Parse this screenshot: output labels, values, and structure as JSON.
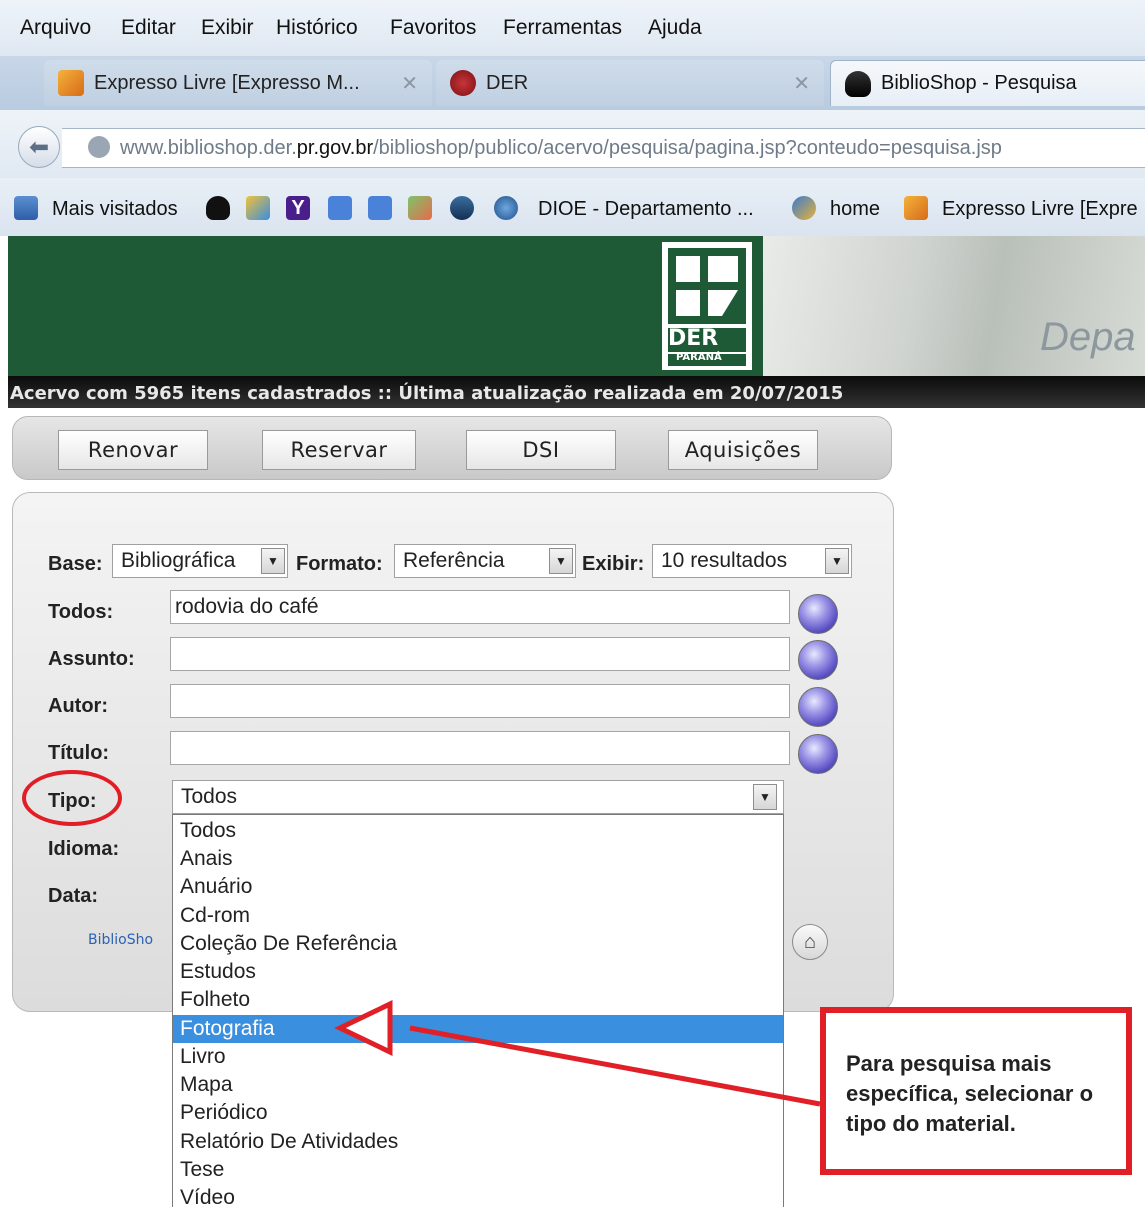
{
  "menu": [
    "Arquivo",
    "Editar",
    "Exibir",
    "Histórico",
    "Favoritos",
    "Ferramentas",
    "Ajuda"
  ],
  "tabs": [
    {
      "title": "Expresso Livre [Expresso M...",
      "icon": "expresso-icon",
      "state": "inactive"
    },
    {
      "title": "DER",
      "icon": "der-shield-icon",
      "state": "inactive"
    },
    {
      "title": "BiblioShop - Pesquisa",
      "icon": "penguin-icon",
      "state": "active"
    }
  ],
  "url": {
    "prefix": "www.biblioshop.der.",
    "domain": "pr.gov.br",
    "path": "/biblioshop/publico/acervo/pesquisa/pagina.jsp?conteudo=pesquisa.jsp"
  },
  "bookmarks": {
    "most_visited": "Mais visitados",
    "dioe": "DIOE - Departamento ...",
    "home": "home",
    "expresso": "Expresso Livre [Expre"
  },
  "banner": {
    "logo_text": "DER",
    "logo_sub": "PARANÁ",
    "road_text": "Depa",
    "status": "Acervo com 5965 itens cadastrados :: Última atualização realizada em 20/07/2015",
    "colors": {
      "green": "#1f5a36",
      "status_bg": "#111111"
    }
  },
  "actions": [
    "Renovar",
    "Reservar",
    "DSI",
    "Aquisições"
  ],
  "search": {
    "base_label": "Base:",
    "base_value": "Bibliográfica",
    "formato_label": "Formato:",
    "formato_value": "Referência",
    "exibir_label": "Exibir:",
    "exibir_value": "10 resultados",
    "todos_label": "Todos:",
    "todos_value": "rodovia do café",
    "assunto_label": "Assunto:",
    "assunto_value": "",
    "autor_label": "Autor:",
    "autor_value": "",
    "titulo_label": "Título:",
    "titulo_value": "",
    "tipo_label": "Tipo:",
    "tipo_value": "Todos",
    "idioma_label": "Idioma:",
    "data_label": "Data:",
    "biblioshop_logo": "BiblioSho"
  },
  "tipo_options": [
    "Todos",
    "Anais",
    "Anuário",
    "Cd-rom",
    "Coleção De Referência",
    "Estudos",
    "Folheto",
    "Fotografia",
    "Livro",
    "Mapa",
    "Periódico",
    "Relatório De Atividades",
    "Tese",
    "Vídeo"
  ],
  "tipo_highlighted": "Fotografia",
  "annotation": {
    "text": "Para pesquisa mais específica, selecionar o tipo do material.",
    "color": "#e01f26"
  }
}
